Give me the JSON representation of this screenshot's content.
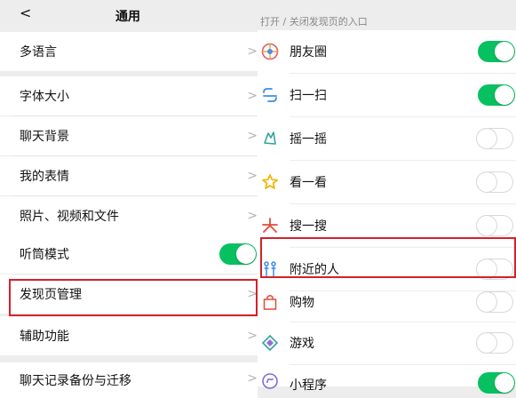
{
  "header": {
    "back_symbol": "<",
    "title": "通用"
  },
  "settings": {
    "language": "多语言",
    "font_size": "字体大小",
    "chat_background": "聊天背景",
    "my_stickers": "我的表情",
    "photos_videos_files": "照片、视频和文件",
    "earpiece_mode": "听筒模式",
    "discover_management": "发现页管理",
    "accessibility": "辅助功能",
    "chat_backup": "聊天记录备份与迁移",
    "chevron": ">",
    "earpiece_mode_on": true
  },
  "discover": {
    "caption": "打开 / 关闭发现页的入口",
    "items": [
      {
        "label": "朋友圈",
        "icon": "moments-icon",
        "on": true
      },
      {
        "label": "扫一扫",
        "icon": "scan-icon",
        "on": true
      },
      {
        "label": "摇一摇",
        "icon": "shake-icon",
        "on": false
      },
      {
        "label": "看一看",
        "icon": "top-stories-icon",
        "on": false
      },
      {
        "label": "搜一搜",
        "icon": "search-icon",
        "on": false
      },
      {
        "label": "附近的人",
        "icon": "people-nearby-icon",
        "on": false
      },
      {
        "label": "购物",
        "icon": "shopping-icon",
        "on": false
      },
      {
        "label": "游戏",
        "icon": "games-icon",
        "on": false
      },
      {
        "label": "小程序",
        "icon": "mini-programs-icon",
        "on": true
      }
    ]
  },
  "colors": {
    "toggle_on": "#07c160",
    "highlight": "#d4212b"
  }
}
